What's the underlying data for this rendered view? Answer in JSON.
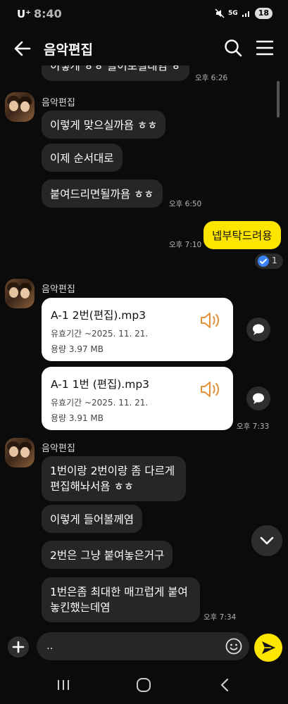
{
  "status_bar": {
    "carrier": "U⁺",
    "time": "8:40",
    "network": "5G",
    "battery": "18"
  },
  "header": {
    "title": "음악편집"
  },
  "messages": {
    "partial_top": "이렇게 ㅎㅎ 들어보실래염 ㅎ",
    "time_1": "오후 6:26",
    "sender_1": "음악편집",
    "m1": "이렇게 맞으실까욤 ㅎㅎ",
    "m2": "이제 순서대로",
    "m3": "붙여드리면될까욤 ㅎㅎ",
    "time_2": "오후 6:50",
    "my_reply": "넵부탁드려용",
    "time_3": "오후 7:10",
    "read_count": "1",
    "sender_2": "음악편집",
    "files": [
      {
        "name": "A-1 2번(편집).mp3",
        "expiry": "유효기간 ~2025. 11. 21.",
        "size": "용량  3.97 MB"
      },
      {
        "name": "A-1 1번 (편집).mp3",
        "expiry": "유효기간 ~2025. 11. 21.",
        "size": "용량  3.91 MB"
      }
    ],
    "time_4": "오후 7:33",
    "sender_3": "음악편집",
    "m4": "1번이랑 2번이랑 좀 다르게 편집해놔서욤 ㅎㅎ",
    "m5": "이렇게 들어볼께염",
    "m6": "2번은 그냥 붙여놓은거구",
    "m7": "1번은좀 최대한 매끄럽게 붙여 놓킨했는데염",
    "time_5": "오후 7:34"
  },
  "input": {
    "value": ".."
  },
  "colors": {
    "accent": "#fee500",
    "bubble": "#262626",
    "background": "#0b0b0b"
  },
  "icons": [
    "back-arrow-icon",
    "search-icon",
    "menu-icon",
    "speaker-icon",
    "share-bubble-icon",
    "check-icon",
    "chevron-down-icon",
    "plus-icon",
    "emoji-icon",
    "send-icon"
  ]
}
